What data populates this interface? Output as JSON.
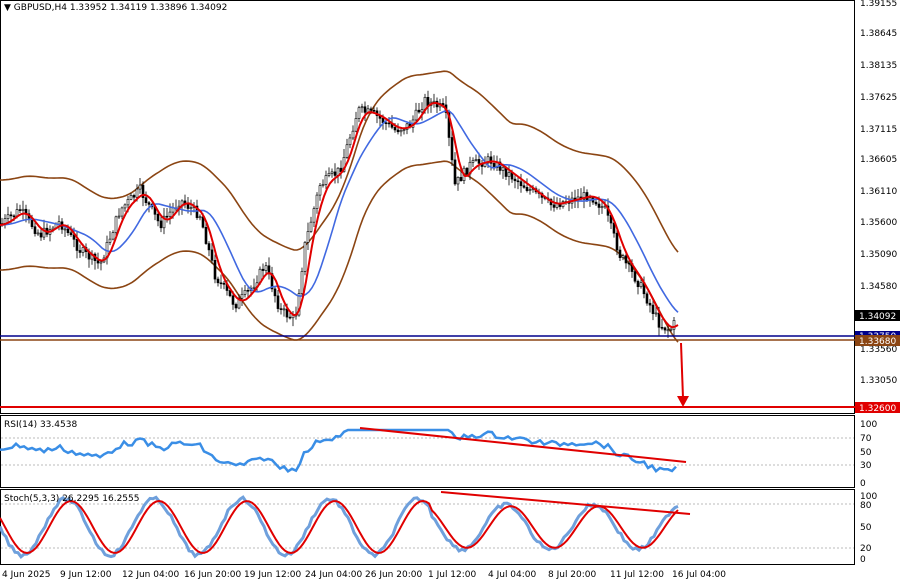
{
  "header": {
    "symbol": "GBPUSD,H4",
    "ohlc": "1.33952 1.34119 1.33896 1.34092"
  },
  "price_scale": [
    "1.39155",
    "1.38645",
    "1.38135",
    "1.37625",
    "1.37115",
    "1.36605",
    "1.36110",
    "1.35600",
    "1.35090",
    "1.34580",
    "1.34070",
    "1.33560",
    "1.33050",
    "1.32540"
  ],
  "price_tags": {
    "current": "1.34092",
    "blue_level": "1.33750",
    "brown_level": "1.33680",
    "red_level": "1.32600"
  },
  "rsi": {
    "label": "RSI(14) 33.4538",
    "scale": [
      "100",
      "70",
      "50",
      "30",
      "0"
    ]
  },
  "stoch": {
    "label": "Stoch(5,3,3) 26.2295 16.2555",
    "scale": [
      "100",
      "80",
      "50",
      "20",
      "0"
    ]
  },
  "time_axis": [
    "4 Jun 2025",
    "9 Jun 12:00",
    "12 Jun 04:00",
    "16 Jun 20:00",
    "19 Jun 12:00",
    "24 Jun 04:00",
    "26 Jun 20:00",
    "1 Jul 12:00",
    "4 Jul 04:00",
    "8 Jul 20:00",
    "11 Jul 12:00",
    "16 Jul 04:00"
  ],
  "colors": {
    "background": "#ffffff",
    "bollinger": "#8B4513",
    "fast_ma": "#e00000",
    "slow_ma": "#4169e1",
    "rsi_line": "#3a8ee6",
    "trendline": "#e00000",
    "support_blue": "#00008b",
    "current_tag": "#000000",
    "target_tag": "#e00000"
  }
}
